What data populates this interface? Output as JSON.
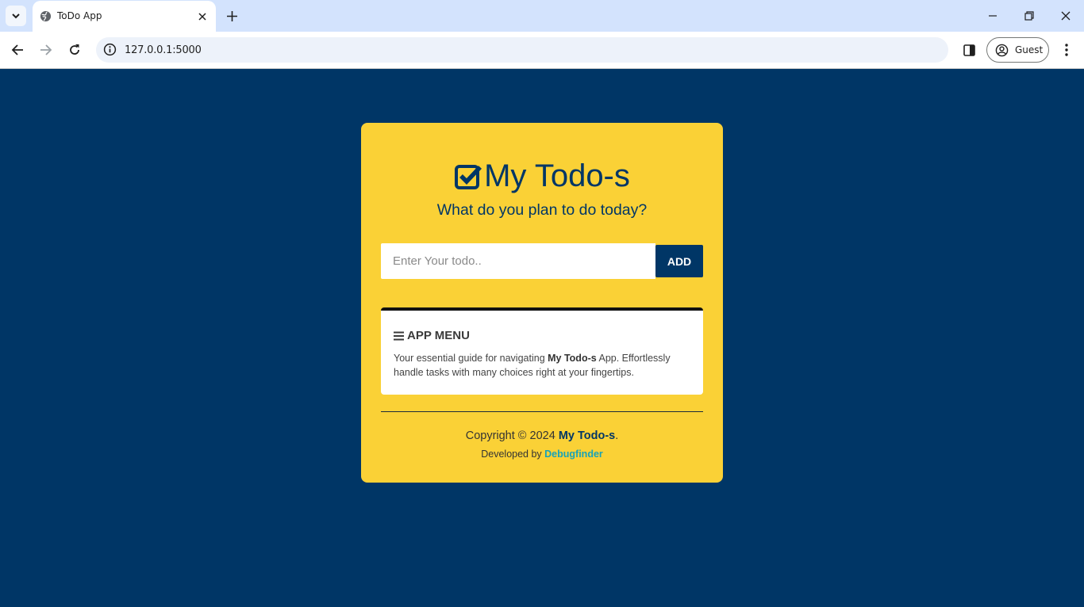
{
  "browser": {
    "tab_title": "ToDo App",
    "url": "127.0.0.1:5000",
    "profile_label": "Guest",
    "icons": [
      "chevron-down-icon",
      "globe-icon",
      "close-icon",
      "plus-icon",
      "minimize-icon",
      "restore-icon",
      "close-icon",
      "back-arrow-icon",
      "forward-arrow-icon",
      "reload-icon",
      "info-icon",
      "side-panel-icon",
      "profile-icon",
      "kebab-menu-icon"
    ]
  },
  "colors": {
    "page_background": "#003666",
    "card_background": "#fad136",
    "primary": "#003666",
    "link": "#17a2b8"
  },
  "app": {
    "title": "My Todo-s",
    "subtitle": "What do you plan to do today?",
    "input_placeholder": "Enter Your todo..",
    "input_value": "",
    "add_label": "ADD"
  },
  "menu": {
    "title": "APP MENU",
    "text_before": "Your essential guide for navigating ",
    "text_bold": "My Todo-s",
    "text_after": " App. Effortlessly handle tasks with many choices right at your fingertips."
  },
  "footer": {
    "copyright_prefix": "Copyright © 2024 ",
    "copyright_brand": "My Todo-s",
    "copyright_suffix": ".",
    "developed_prefix": "Developed by ",
    "developer_link": "Debugfinder"
  }
}
